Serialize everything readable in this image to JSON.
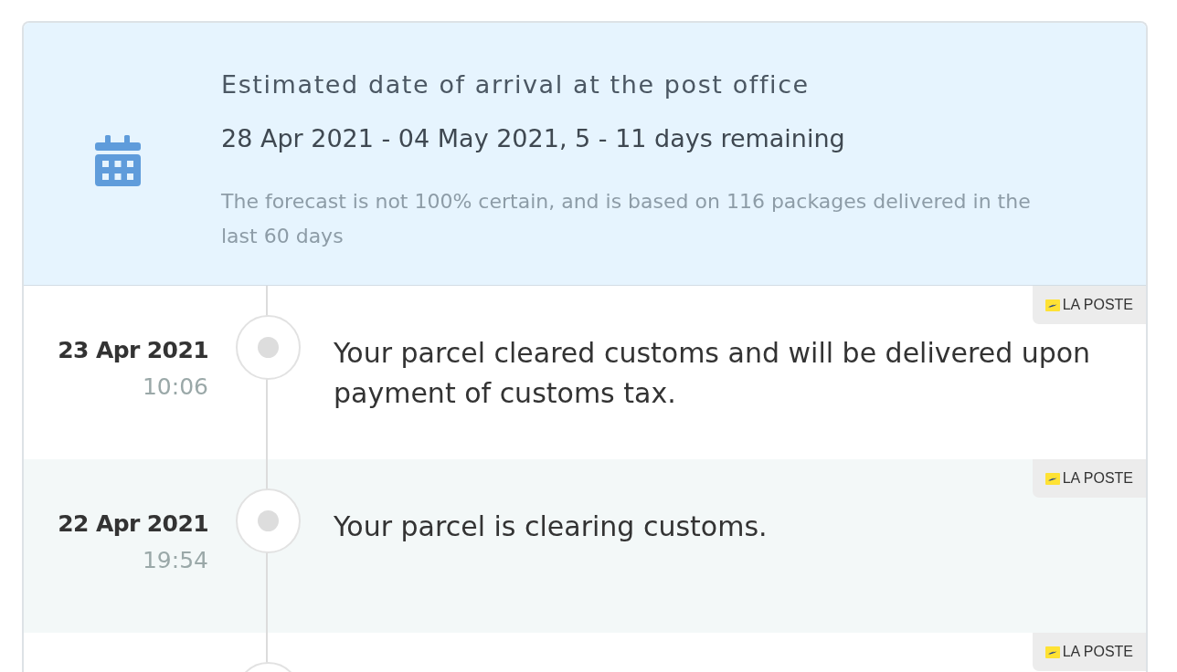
{
  "forecast": {
    "title": "Estimated date of arrival at the post office",
    "range": "28 Apr 2021 - 04 May 2021, 5 - 11 days remaining",
    "note": "The forecast is not 100% certain, and is based on 116 packages delivered in the last 60 days"
  },
  "events": [
    {
      "carrier": "LA POSTE",
      "date": "23 Apr 2021",
      "time": "10:06",
      "text": "Your parcel cleared customs and will be delivered upon payment of customs tax."
    },
    {
      "carrier": "LA POSTE",
      "date": "22 Apr 2021",
      "time": "19:54",
      "text": "Your parcel is clearing customs."
    },
    {
      "carrier": "LA POSTE"
    }
  ]
}
